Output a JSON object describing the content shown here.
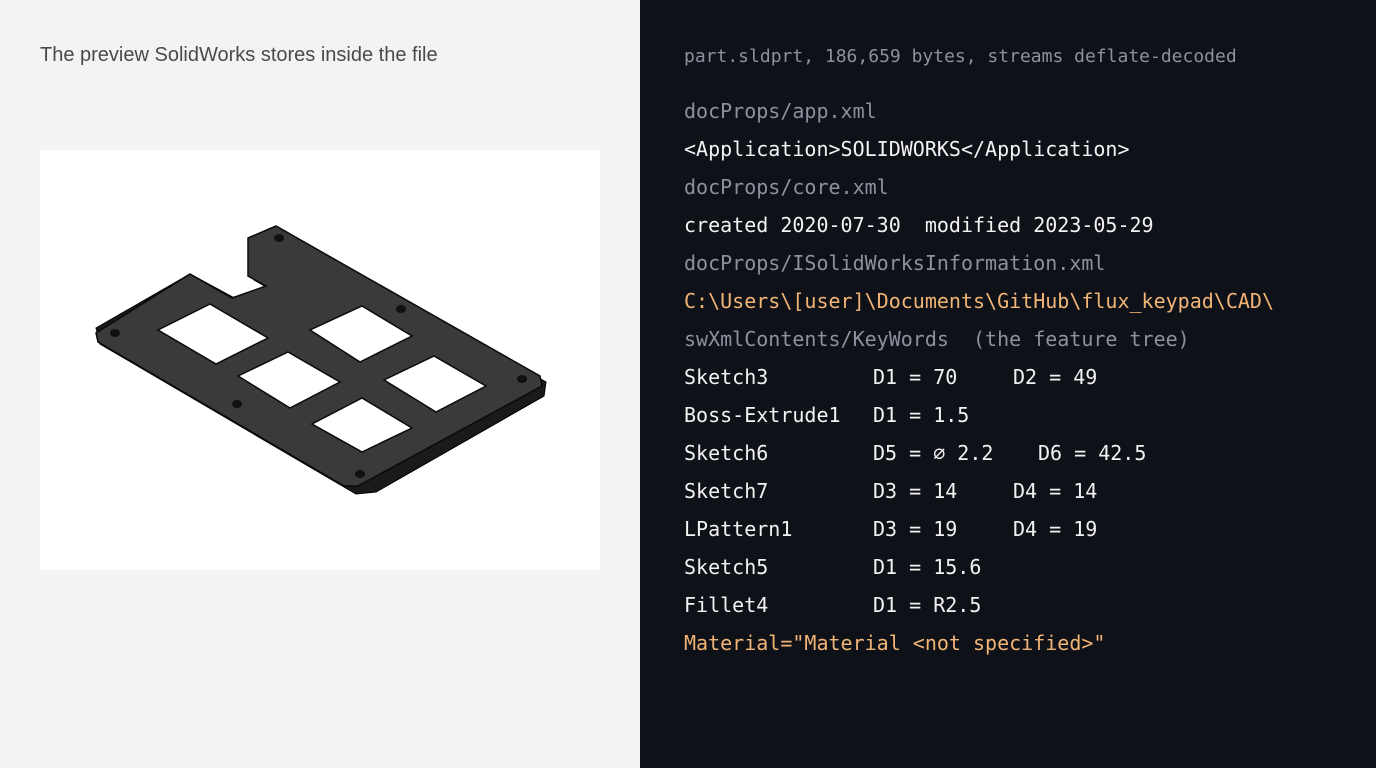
{
  "colors": {
    "left_bg": "#f3f3f1",
    "right_bg": "#0e1117",
    "muted": "#8b919e",
    "bright": "#f2f2f2",
    "accent": "#f2b476",
    "caption": "#4a4a4a"
  },
  "preview": {
    "caption": "The preview SolidWorks stores inside the file"
  },
  "terminal": {
    "header": "part.sldprt, 186,659 bytes, streams deflate-decoded",
    "app_xml_label": "docProps/app.xml",
    "app_xml_value": "<Application>SOLIDWORKS</Application>",
    "core_xml_label": "docProps/core.xml",
    "core_xml_value": "created 2020-07-30  modified 2023-05-29",
    "sw_info_label": "docProps/ISolidWorksInformation.xml",
    "sw_info_value": "C:\\Users\\[user]\\Documents\\GitHub\\flux_keypad\\CAD\\",
    "keywords_label": "swXmlContents/KeyWords  (the feature tree)",
    "keywords": [
      {
        "feature": "Sketch3",
        "param1": "D1 = 70",
        "param2": "D2 = 49"
      },
      {
        "feature": "Boss-Extrude1",
        "param1": "D1 = 1.5",
        "param2": ""
      },
      {
        "feature": "Sketch6",
        "param1": "D5 = ⌀ 2.2",
        "param2": "D6 = 42.5"
      },
      {
        "feature": "Sketch7",
        "param1": "D3 = 14",
        "param2": "D4 = 14"
      },
      {
        "feature": "LPattern1",
        "param1": "D3 = 19",
        "param2": "D4 = 19"
      },
      {
        "feature": "Sketch5",
        "param1": "D1 = 15.6",
        "param2": ""
      },
      {
        "feature": "Fillet4",
        "param1": "D1 = R2.5",
        "param2": ""
      }
    ],
    "material": "Material=\"Material <not specified>\""
  }
}
